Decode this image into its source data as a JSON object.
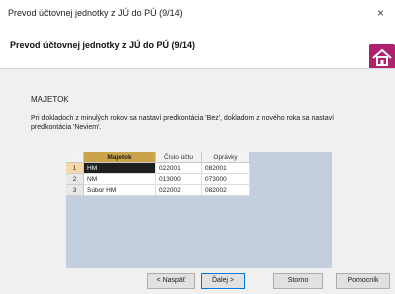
{
  "window": {
    "title": "Prevod účtovnej jednotky z JÚ do PÚ (9/14)",
    "close_glyph": "×"
  },
  "header": {
    "title": "Prevod účtovnej jednotky z JÚ do PÚ (9/14)",
    "icon": "home-icon"
  },
  "section": {
    "label": "MAJETOK",
    "description": "Pri dokladoch z minulých rokov sa nastaví predkontácia 'Bez', dokladom z nového roka sa nastaví predkontácia 'Neviem'."
  },
  "table": {
    "columns": [
      "Majetok",
      "Číslo účtu",
      "Oprávky"
    ],
    "rows": [
      {
        "num": "1",
        "majetok": "HM",
        "cislo_uctu": "022001",
        "opravky": "082001",
        "selected": true
      },
      {
        "num": "2",
        "majetok": "NM",
        "cislo_uctu": "013000",
        "opravky": "073000",
        "selected": false
      },
      {
        "num": "3",
        "majetok": "Súbor HM",
        "cislo_uctu": "022002",
        "opravky": "082002",
        "selected": false
      }
    ]
  },
  "buttons": {
    "back": "< Naspäť",
    "next": "Ďalej >",
    "cancel": "Storno",
    "help": "Pomocník"
  },
  "colors": {
    "grid_bg": "#c4cfde",
    "header_highlight": "#c9a44a",
    "selected_cell": "#1f1f1f",
    "home_icon": "#b0206e"
  }
}
